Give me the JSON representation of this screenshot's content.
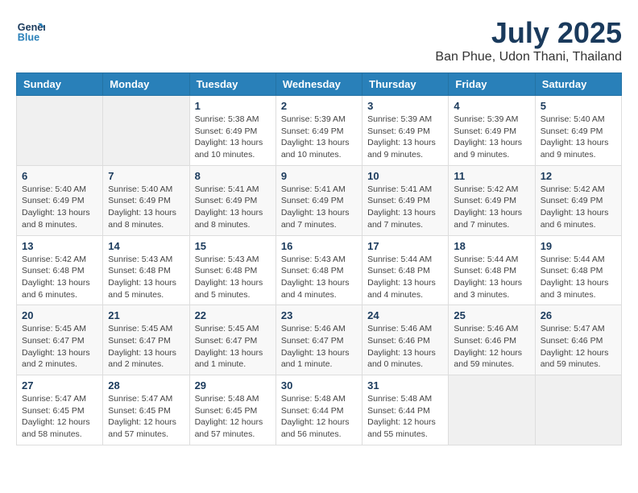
{
  "header": {
    "logo_line1": "General",
    "logo_line2": "Blue",
    "month": "July 2025",
    "location": "Ban Phue, Udon Thani, Thailand"
  },
  "weekdays": [
    "Sunday",
    "Monday",
    "Tuesday",
    "Wednesday",
    "Thursday",
    "Friday",
    "Saturday"
  ],
  "weeks": [
    [
      {
        "day": "",
        "info": ""
      },
      {
        "day": "",
        "info": ""
      },
      {
        "day": "1",
        "info": "Sunrise: 5:38 AM\nSunset: 6:49 PM\nDaylight: 13 hours and 10 minutes."
      },
      {
        "day": "2",
        "info": "Sunrise: 5:39 AM\nSunset: 6:49 PM\nDaylight: 13 hours and 10 minutes."
      },
      {
        "day": "3",
        "info": "Sunrise: 5:39 AM\nSunset: 6:49 PM\nDaylight: 13 hours and 9 minutes."
      },
      {
        "day": "4",
        "info": "Sunrise: 5:39 AM\nSunset: 6:49 PM\nDaylight: 13 hours and 9 minutes."
      },
      {
        "day": "5",
        "info": "Sunrise: 5:40 AM\nSunset: 6:49 PM\nDaylight: 13 hours and 9 minutes."
      }
    ],
    [
      {
        "day": "6",
        "info": "Sunrise: 5:40 AM\nSunset: 6:49 PM\nDaylight: 13 hours and 8 minutes."
      },
      {
        "day": "7",
        "info": "Sunrise: 5:40 AM\nSunset: 6:49 PM\nDaylight: 13 hours and 8 minutes."
      },
      {
        "day": "8",
        "info": "Sunrise: 5:41 AM\nSunset: 6:49 PM\nDaylight: 13 hours and 8 minutes."
      },
      {
        "day": "9",
        "info": "Sunrise: 5:41 AM\nSunset: 6:49 PM\nDaylight: 13 hours and 7 minutes."
      },
      {
        "day": "10",
        "info": "Sunrise: 5:41 AM\nSunset: 6:49 PM\nDaylight: 13 hours and 7 minutes."
      },
      {
        "day": "11",
        "info": "Sunrise: 5:42 AM\nSunset: 6:49 PM\nDaylight: 13 hours and 7 minutes."
      },
      {
        "day": "12",
        "info": "Sunrise: 5:42 AM\nSunset: 6:49 PM\nDaylight: 13 hours and 6 minutes."
      }
    ],
    [
      {
        "day": "13",
        "info": "Sunrise: 5:42 AM\nSunset: 6:48 PM\nDaylight: 13 hours and 6 minutes."
      },
      {
        "day": "14",
        "info": "Sunrise: 5:43 AM\nSunset: 6:48 PM\nDaylight: 13 hours and 5 minutes."
      },
      {
        "day": "15",
        "info": "Sunrise: 5:43 AM\nSunset: 6:48 PM\nDaylight: 13 hours and 5 minutes."
      },
      {
        "day": "16",
        "info": "Sunrise: 5:43 AM\nSunset: 6:48 PM\nDaylight: 13 hours and 4 minutes."
      },
      {
        "day": "17",
        "info": "Sunrise: 5:44 AM\nSunset: 6:48 PM\nDaylight: 13 hours and 4 minutes."
      },
      {
        "day": "18",
        "info": "Sunrise: 5:44 AM\nSunset: 6:48 PM\nDaylight: 13 hours and 3 minutes."
      },
      {
        "day": "19",
        "info": "Sunrise: 5:44 AM\nSunset: 6:48 PM\nDaylight: 13 hours and 3 minutes."
      }
    ],
    [
      {
        "day": "20",
        "info": "Sunrise: 5:45 AM\nSunset: 6:47 PM\nDaylight: 13 hours and 2 minutes."
      },
      {
        "day": "21",
        "info": "Sunrise: 5:45 AM\nSunset: 6:47 PM\nDaylight: 13 hours and 2 minutes."
      },
      {
        "day": "22",
        "info": "Sunrise: 5:45 AM\nSunset: 6:47 PM\nDaylight: 13 hours and 1 minute."
      },
      {
        "day": "23",
        "info": "Sunrise: 5:46 AM\nSunset: 6:47 PM\nDaylight: 13 hours and 1 minute."
      },
      {
        "day": "24",
        "info": "Sunrise: 5:46 AM\nSunset: 6:46 PM\nDaylight: 13 hours and 0 minutes."
      },
      {
        "day": "25",
        "info": "Sunrise: 5:46 AM\nSunset: 6:46 PM\nDaylight: 12 hours and 59 minutes."
      },
      {
        "day": "26",
        "info": "Sunrise: 5:47 AM\nSunset: 6:46 PM\nDaylight: 12 hours and 59 minutes."
      }
    ],
    [
      {
        "day": "27",
        "info": "Sunrise: 5:47 AM\nSunset: 6:45 PM\nDaylight: 12 hours and 58 minutes."
      },
      {
        "day": "28",
        "info": "Sunrise: 5:47 AM\nSunset: 6:45 PM\nDaylight: 12 hours and 57 minutes."
      },
      {
        "day": "29",
        "info": "Sunrise: 5:48 AM\nSunset: 6:45 PM\nDaylight: 12 hours and 57 minutes."
      },
      {
        "day": "30",
        "info": "Sunrise: 5:48 AM\nSunset: 6:44 PM\nDaylight: 12 hours and 56 minutes."
      },
      {
        "day": "31",
        "info": "Sunrise: 5:48 AM\nSunset: 6:44 PM\nDaylight: 12 hours and 55 minutes."
      },
      {
        "day": "",
        "info": ""
      },
      {
        "day": "",
        "info": ""
      }
    ]
  ]
}
